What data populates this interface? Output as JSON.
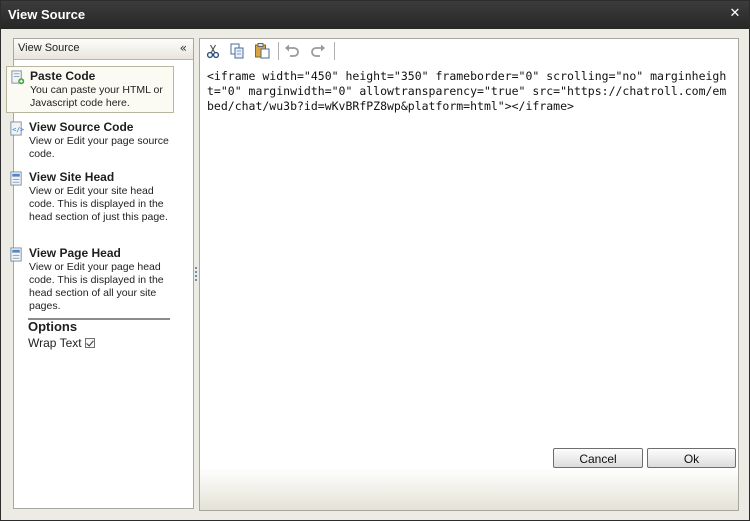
{
  "dialog": {
    "title": "View Source",
    "close_icon": "close-icon"
  },
  "sidebar": {
    "header": "View Source",
    "collapse_glyph": "«",
    "items": [
      {
        "title": "Paste Code",
        "desc": "You can paste your HTML or Javascript code here.",
        "icon": "paste-code-icon"
      },
      {
        "title": "View Source Code",
        "desc": "View or Edit your page source code.",
        "icon": "source-code-icon"
      },
      {
        "title": "View Site Head",
        "desc": "View or Edit your site head code. This is displayed in the head section of just this page.",
        "icon": "site-head-icon"
      },
      {
        "title": "View Page Head",
        "desc": "View or Edit your page head code. This is displayed in the head section of all your site pages.",
        "icon": "page-head-icon"
      }
    ],
    "options": {
      "title": "Options",
      "wrap_text_label": "Wrap Text",
      "wrap_text_checked": true
    }
  },
  "toolbar": {
    "buttons": [
      "cut-icon",
      "copy-icon",
      "paste-icon",
      "undo-icon",
      "redo-icon"
    ]
  },
  "editor": {
    "code": "<iframe width=\"450\" height=\"350\" frameborder=\"0\" scrolling=\"no\" marginheight=\"0\" marginwidth=\"0\" allowtransparency=\"true\" src=\"https://chatroll.com/embed/chat/wu3b?id=wKvBRfPZ8wp&platform=html\"></iframe>"
  },
  "footer": {
    "cancel_label": "Cancel",
    "ok_label": "Ok"
  }
}
